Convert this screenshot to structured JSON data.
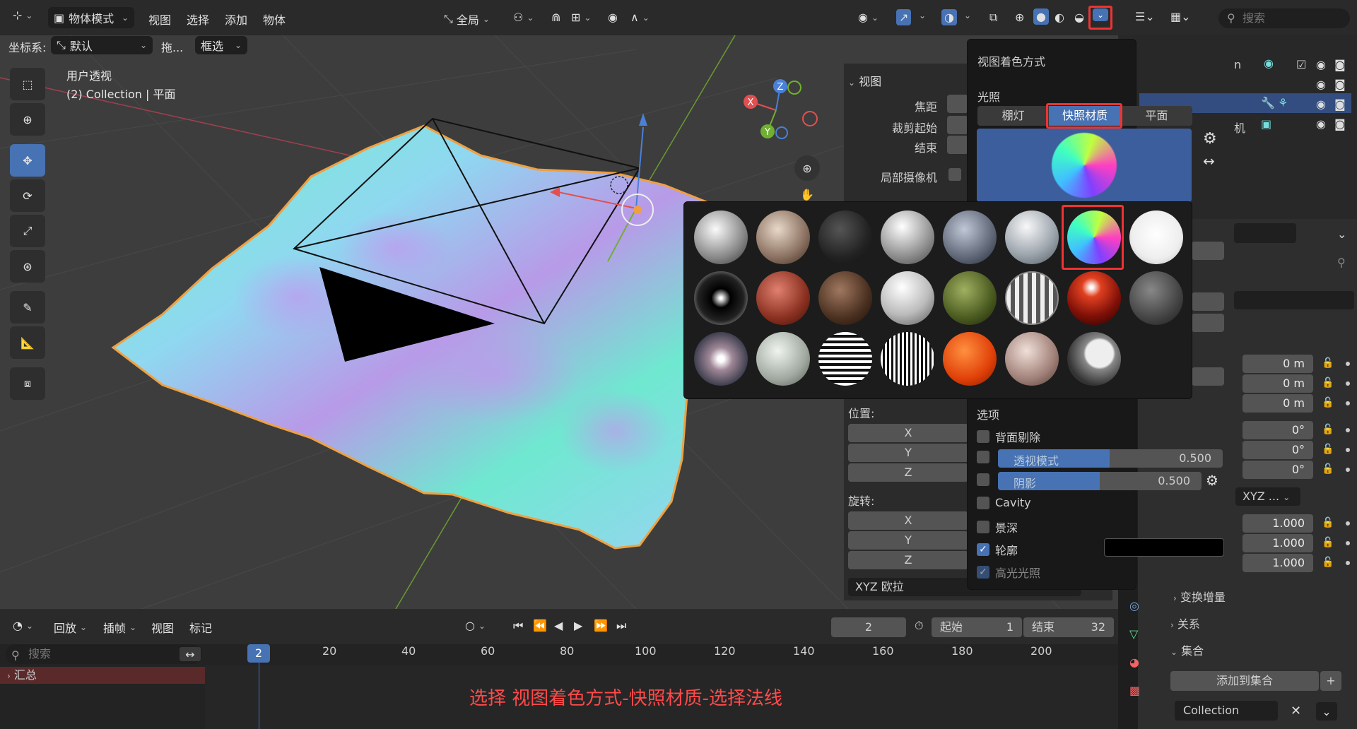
{
  "header": {
    "mode": "物体模式",
    "menus": [
      "视图",
      "选择",
      "添加",
      "物体"
    ],
    "transform": "全局",
    "coord_label": "坐标系:",
    "coord_value": "默认",
    "drag_label": "拖...",
    "select_mode": "框选",
    "search_placeholder": "搜索"
  },
  "viewport": {
    "view_name": "用户透视",
    "collection_line": "(2) Collection | 平面",
    "gizmo": {
      "x": "X",
      "y": "Y",
      "z": "Z"
    }
  },
  "n_panel": {
    "section": "视图",
    "focal": "焦距",
    "clip_start": "裁剪起始",
    "clip_end": "结束",
    "local_camera": "局部摄像机",
    "location": "位置:",
    "rotation": "旋转:",
    "axes": [
      "X",
      "Y",
      "Z"
    ],
    "euler": "XYZ 欧拉"
  },
  "shading_popup": {
    "title": "视图着色方式",
    "lighting": "光照",
    "tabs": [
      "棚灯",
      "快照材质",
      "平面"
    ],
    "active_tab": "快照材质",
    "options": "选项",
    "backface": "背面剔除",
    "xray": "透视模式",
    "xray_value": "0.500",
    "shadow": "阴影",
    "shadow_value": "0.500",
    "cavity": "Cavity",
    "dof": "景深",
    "outline": "轮廓",
    "specular": "高光光照"
  },
  "properties": {
    "loc": [
      "0 m",
      "0 m",
      "0 m"
    ],
    "rot": [
      "0°",
      "0°",
      "0°"
    ],
    "rot_mode": "XYZ ...",
    "scale": [
      "1.000",
      "1.000",
      "1.000"
    ],
    "delta": "变换增量",
    "relations": "关系",
    "collections": "集合",
    "add_to_collection": "添加到集合",
    "collection_name": "Collection"
  },
  "outliner": {
    "row_partial": [
      "n",
      "",
      "",
      "机"
    ]
  },
  "timeline": {
    "menus": [
      "回放",
      "插帧",
      "视图",
      "标记"
    ],
    "current_frame": "2",
    "start_label": "起始",
    "start": "1",
    "end_label": "结束",
    "end": "32",
    "search_placeholder": "搜索",
    "summary": "汇总",
    "ruler": [
      "20",
      "40",
      "60",
      "80",
      "100",
      "120",
      "140",
      "160",
      "180",
      "200"
    ],
    "playhead": "2"
  },
  "annotation": "选择 视图着色方式-快照材质-选择法线",
  "colors": {
    "accent": "#4772b3",
    "highlight_box": "#ee3333",
    "annotation": "#ff4a4a",
    "selection_outline": "#f0a040"
  }
}
